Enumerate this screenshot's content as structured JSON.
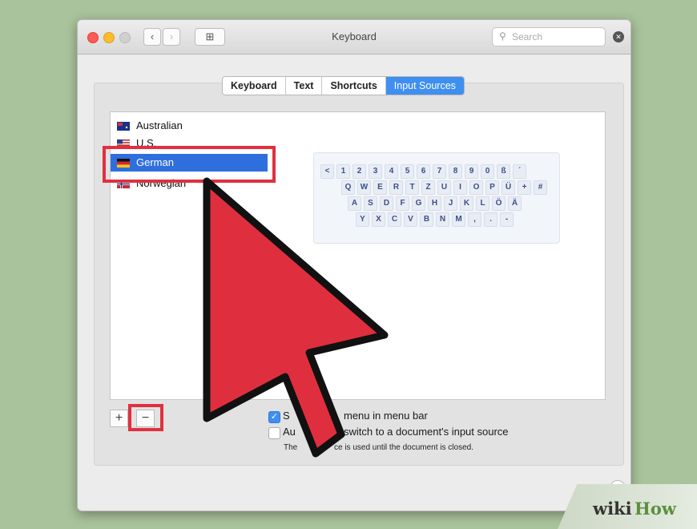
{
  "window": {
    "title": "Keyboard",
    "back_glyph": "‹",
    "forward_glyph": "›",
    "grid_glyph": "⊞",
    "search_placeholder": "Search",
    "search_icon": "search-icon",
    "clear_glyph": "✕"
  },
  "tabs": [
    {
      "label": "Keyboard",
      "active": false
    },
    {
      "label": "Text",
      "active": false
    },
    {
      "label": "Shortcuts",
      "active": false
    },
    {
      "label": "Input Sources",
      "active": true
    }
  ],
  "input_sources": [
    {
      "label": "Australian",
      "selected": false
    },
    {
      "label": "U.S.",
      "selected": false
    },
    {
      "label": "German",
      "selected": true
    },
    {
      "label": "Norwegian",
      "selected": false
    }
  ],
  "keyboard_preview": {
    "rows": [
      [
        "<",
        "1",
        "2",
        "3",
        "4",
        "5",
        "6",
        "7",
        "8",
        "9",
        "0",
        "ß",
        "´"
      ],
      [
        "Q",
        "W",
        "E",
        "R",
        "T",
        "Z",
        "U",
        "I",
        "O",
        "P",
        "Ü",
        "+",
        "#"
      ],
      [
        "A",
        "S",
        "D",
        "F",
        "G",
        "H",
        "J",
        "K",
        "L",
        "Ö",
        "Ä"
      ],
      [
        "Y",
        "X",
        "C",
        "V",
        "B",
        "N",
        "M",
        ",",
        ".",
        "-"
      ]
    ]
  },
  "buttons": {
    "add": "+",
    "remove": "−",
    "help": "?"
  },
  "options": {
    "show_menu_label": "menu in menu bar",
    "show_menu_prefix": "S",
    "show_menu_checked": true,
    "auto_switch_prefix": "Au",
    "auto_switch_label": "switch to a document's input source",
    "auto_switch_checked": false,
    "note_prefix": "The",
    "note_text": "ce is used until the document is closed."
  },
  "watermark": {
    "part1": "wiki",
    "part2": "How"
  },
  "colors": {
    "accent": "#3f8ff0",
    "selection": "#2e6fdd",
    "highlight_red": "#e0303f",
    "arrow_red": "#df2f3e"
  }
}
